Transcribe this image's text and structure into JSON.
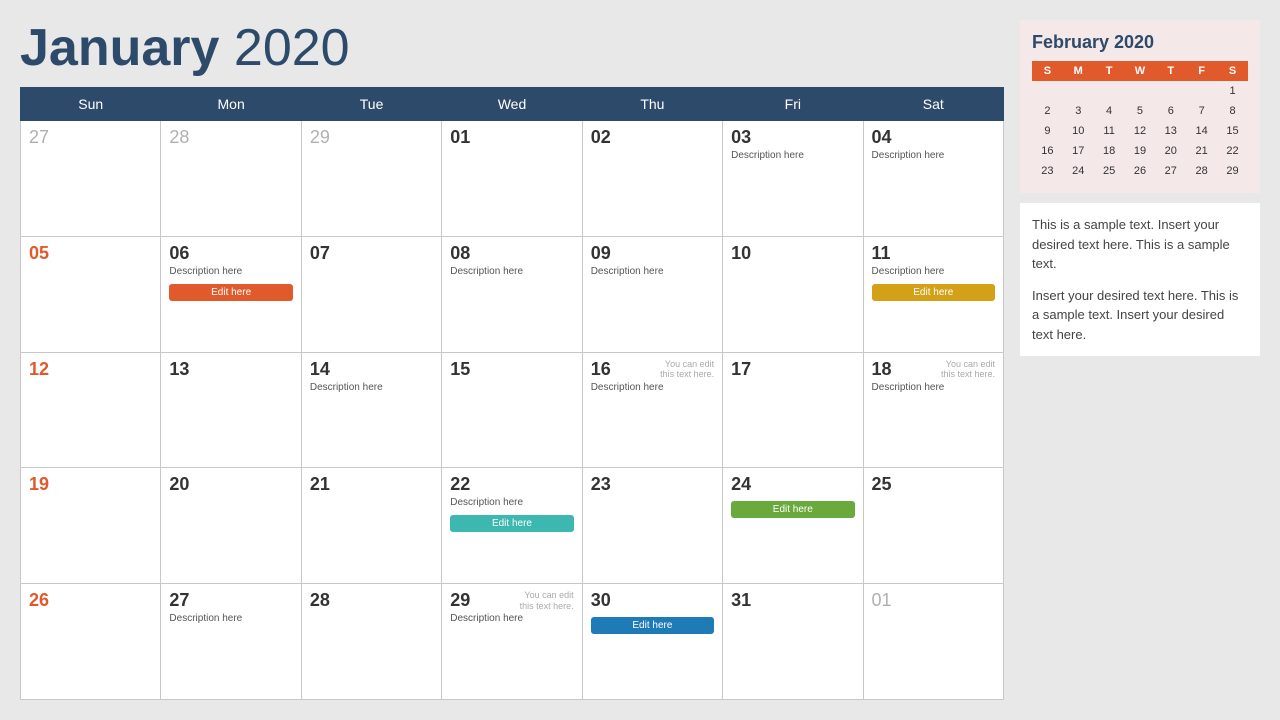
{
  "header": {
    "month": "January",
    "year": "2020"
  },
  "days_of_week": [
    "Sun",
    "Mon",
    "Tue",
    "Wed",
    "Thu",
    "Fri",
    "Sat"
  ],
  "weeks": [
    [
      {
        "num": "27",
        "outside": true,
        "sunday": false
      },
      {
        "num": "28",
        "outside": true,
        "sunday": false
      },
      {
        "num": "29",
        "outside": true,
        "sunday": false
      },
      {
        "num": "01",
        "outside": false,
        "sunday": false,
        "desc": ""
      },
      {
        "num": "02",
        "outside": false,
        "sunday": false,
        "desc": ""
      },
      {
        "num": "03",
        "outside": false,
        "sunday": false,
        "desc": "Description here"
      },
      {
        "num": "04",
        "outside": false,
        "sunday": false,
        "desc": "Description here"
      }
    ],
    [
      {
        "num": "05",
        "outside": false,
        "sunday": true,
        "desc": ""
      },
      {
        "num": "06",
        "outside": false,
        "sunday": false,
        "desc": "Description here",
        "btn": "Edit here",
        "btn_color": "orange"
      },
      {
        "num": "07",
        "outside": false,
        "sunday": false,
        "desc": ""
      },
      {
        "num": "08",
        "outside": false,
        "sunday": false,
        "desc": "Description here"
      },
      {
        "num": "09",
        "outside": false,
        "sunday": false,
        "desc": "Description here"
      },
      {
        "num": "10",
        "outside": false,
        "sunday": false,
        "desc": ""
      },
      {
        "num": "11",
        "outside": false,
        "sunday": false,
        "desc": "Description here",
        "btn": "Edit here",
        "btn_color": "yellow"
      }
    ],
    [
      {
        "num": "12",
        "outside": false,
        "sunday": true,
        "desc": ""
      },
      {
        "num": "13",
        "outside": false,
        "sunday": false,
        "desc": ""
      },
      {
        "num": "14",
        "outside": false,
        "sunday": false,
        "desc": "Description here"
      },
      {
        "num": "15",
        "outside": false,
        "sunday": false,
        "desc": ""
      },
      {
        "num": "16",
        "outside": false,
        "sunday": false,
        "desc": "Description here",
        "note": "You can edit this text here."
      },
      {
        "num": "17",
        "outside": false,
        "sunday": false,
        "desc": ""
      },
      {
        "num": "18",
        "outside": false,
        "sunday": false,
        "desc": "Description here",
        "note": "You can edit this text here."
      }
    ],
    [
      {
        "num": "19",
        "outside": false,
        "sunday": true,
        "desc": ""
      },
      {
        "num": "20",
        "outside": false,
        "sunday": false,
        "desc": ""
      },
      {
        "num": "21",
        "outside": false,
        "sunday": false,
        "desc": ""
      },
      {
        "num": "22",
        "outside": false,
        "sunday": false,
        "desc": "Description here",
        "btn": "Edit here",
        "btn_color": "teal"
      },
      {
        "num": "23",
        "outside": false,
        "sunday": false,
        "desc": ""
      },
      {
        "num": "24",
        "outside": false,
        "sunday": false,
        "desc": "",
        "btn": "Edit here",
        "btn_color": "green"
      },
      {
        "num": "25",
        "outside": false,
        "sunday": false,
        "desc": ""
      }
    ],
    [
      {
        "num": "26",
        "outside": false,
        "sunday": true,
        "desc": ""
      },
      {
        "num": "27",
        "outside": false,
        "sunday": false,
        "desc": "Description here"
      },
      {
        "num": "28",
        "outside": false,
        "sunday": false,
        "desc": ""
      },
      {
        "num": "29",
        "outside": false,
        "sunday": false,
        "desc": "Description here",
        "note": "You can edit this text here."
      },
      {
        "num": "30",
        "outside": false,
        "sunday": false,
        "desc": "",
        "btn": "Edit here",
        "btn_color": "blue"
      },
      {
        "num": "31",
        "outside": false,
        "sunday": false,
        "desc": ""
      },
      {
        "num": "01",
        "outside": true,
        "sunday": false,
        "desc": ""
      }
    ]
  ],
  "sidebar": {
    "mini_cal_title": "February 2020",
    "mini_cal_days": [
      "S",
      "M",
      "T",
      "W",
      "T",
      "F",
      "S"
    ],
    "mini_cal_weeks": [
      [
        "",
        "",
        "",
        "",
        "",
        "",
        "1"
      ],
      [
        "2",
        "3",
        "4",
        "5",
        "6",
        "7",
        "8"
      ],
      [
        "9",
        "10",
        "11",
        "12",
        "13",
        "14",
        "15"
      ],
      [
        "16",
        "17",
        "18",
        "19",
        "20",
        "21",
        "22"
      ],
      [
        "23",
        "24",
        "25",
        "26",
        "27",
        "28",
        "29"
      ]
    ],
    "text1": "This is a sample text. Insert your desired text here. This is a sample text.",
    "text2": "Insert your desired text here. This is a sample text. Insert your desired text here."
  }
}
